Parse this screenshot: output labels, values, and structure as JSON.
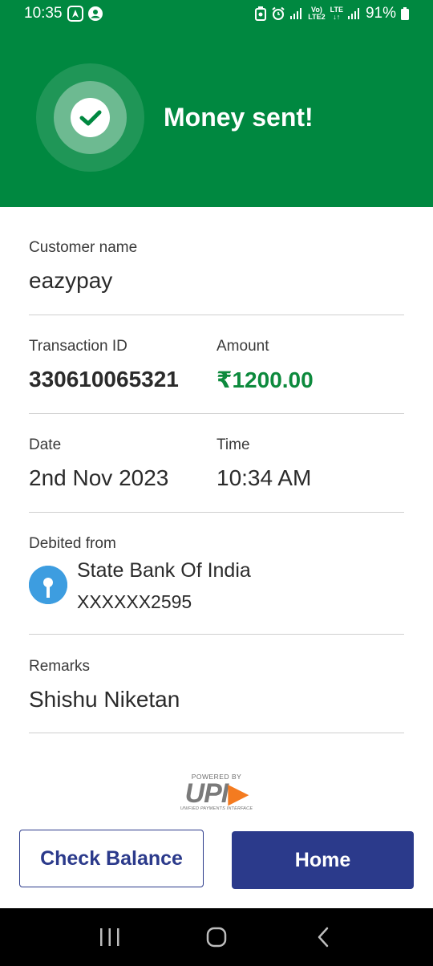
{
  "status_bar": {
    "time": "10:35",
    "volte_top": "Vo)",
    "volte_bottom": "LTE2",
    "lte": "LTE",
    "battery": "91%"
  },
  "header": {
    "title": "Money sent!"
  },
  "customer": {
    "label": "Customer name",
    "value": "eazypay"
  },
  "transaction": {
    "id_label": "Transaction ID",
    "id_value": "330610065321",
    "amount_label": "Amount",
    "amount_value": "₹1200.00"
  },
  "datetime": {
    "date_label": "Date",
    "date_value": "2nd Nov 2023",
    "time_label": "Time",
    "time_value": "10:34 AM"
  },
  "debit": {
    "label": "Debited from",
    "bank_name": "State Bank Of India",
    "account": "XXXXXX2595"
  },
  "remarks": {
    "label": "Remarks",
    "value": "Shishu Niketan"
  },
  "upi": {
    "powered_by": "POWERED BY",
    "logo_text": "UPI",
    "subtitle": "UNIFIED PAYMENTS INTERFACE"
  },
  "buttons": {
    "check_balance": "Check Balance",
    "home": "Home"
  },
  "colors": {
    "header_green": "#008840",
    "amount_green": "#0d8a3d",
    "button_blue": "#2b3a8b",
    "bank_blue": "#3d9de0"
  }
}
